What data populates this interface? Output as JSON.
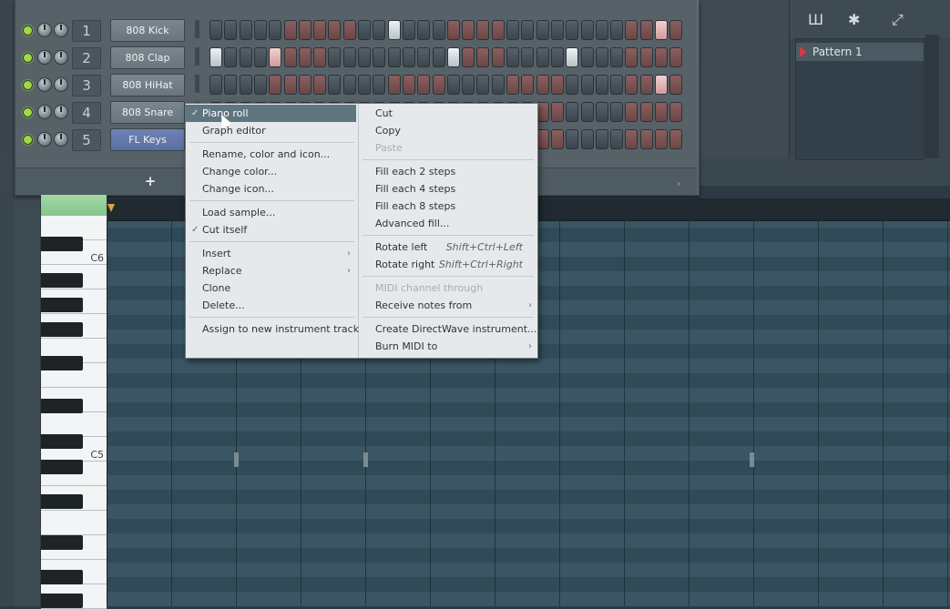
{
  "channels": [
    {
      "num": "1",
      "name": "808 Kick"
    },
    {
      "num": "2",
      "name": "808 Clap"
    },
    {
      "num": "3",
      "name": "808 HiHat"
    },
    {
      "num": "4",
      "name": "808 Snare"
    },
    {
      "num": "5",
      "name": "FL Keys"
    }
  ],
  "rack": {
    "add_label": "+",
    "scroll_arrow": "›"
  },
  "playlist": {
    "pattern_name": "Pattern 1"
  },
  "toolbar": {
    "piano_icon": "Ш",
    "wave_icon": "✱",
    "link_icon": "⤢"
  },
  "keyboard": {
    "c6": "C6",
    "c5": "C5"
  },
  "menu": {
    "left": [
      {
        "label": "Piano roll",
        "checked": true,
        "highlight": true
      },
      {
        "label": "Graph editor"
      },
      {
        "label": "Rename, color and icon..."
      },
      {
        "label": "Change color..."
      },
      {
        "label": "Change icon..."
      },
      {
        "label": "Load sample..."
      },
      {
        "label": "Cut itself",
        "checked": true
      },
      {
        "label": "Insert",
        "submenu": true
      },
      {
        "label": "Replace",
        "submenu": true
      },
      {
        "label": "Clone"
      },
      {
        "label": "Delete..."
      },
      {
        "label": "Assign to new instrument track"
      }
    ],
    "right": [
      {
        "label": "Cut"
      },
      {
        "label": "Copy"
      },
      {
        "label": "Paste",
        "disabled": true
      },
      {
        "label": "Fill each 2 steps"
      },
      {
        "label": "Fill each 4 steps"
      },
      {
        "label": "Fill each 8 steps"
      },
      {
        "label": "Advanced fill..."
      },
      {
        "label": "Rotate left",
        "shortcut": "Shift+Ctrl+Left"
      },
      {
        "label": "Rotate right",
        "shortcut": "Shift+Ctrl+Right"
      },
      {
        "label": "MIDI channel through",
        "disabled": true
      },
      {
        "label": "Receive notes from",
        "submenu": true
      },
      {
        "label": "Create DirectWave instrument..."
      },
      {
        "label": "Burn MIDI to",
        "submenu": true
      }
    ]
  },
  "check_glyph": "✓",
  "submenu_glyph": "›",
  "colors": {
    "accent_green": "#9fd84a",
    "highlight": "#5f7680",
    "pattern_marker": "#d23a4a"
  }
}
